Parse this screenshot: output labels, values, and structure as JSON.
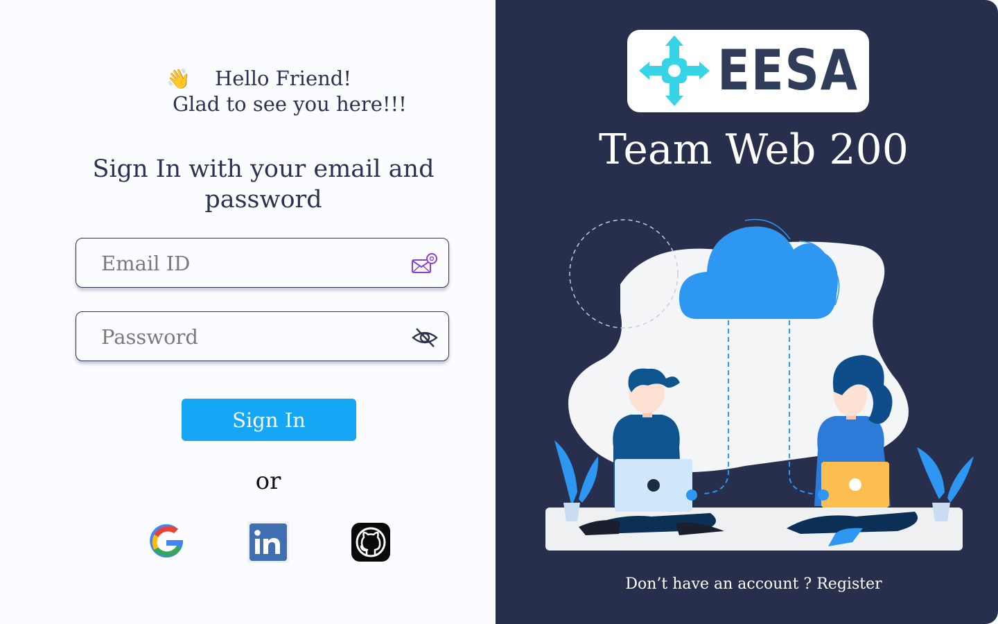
{
  "greeting": {
    "emoji": "👋",
    "line1": "Hello Friend!",
    "line2": "Glad to see you here!!!"
  },
  "form": {
    "heading": "Sign In with your email and password",
    "email_placeholder": "Email ID",
    "password_placeholder": "Password",
    "email_icon": "mail-at-icon",
    "password_icon": "eye-slash-icon",
    "signin_label": "Sign In",
    "or_label": "or"
  },
  "social": {
    "providers": [
      "Google",
      "LinkedIn",
      "GitHub"
    ]
  },
  "brand": {
    "logo_text": "EESA",
    "title": "Team Web 200",
    "logo_color": "#37d3e6",
    "panel_color": "#282f4c"
  },
  "footer": {
    "prompt": "Don’t have an account ?",
    "register_label": "Register"
  },
  "colors": {
    "accent": "#16a6f6",
    "text": "#2b3150"
  }
}
